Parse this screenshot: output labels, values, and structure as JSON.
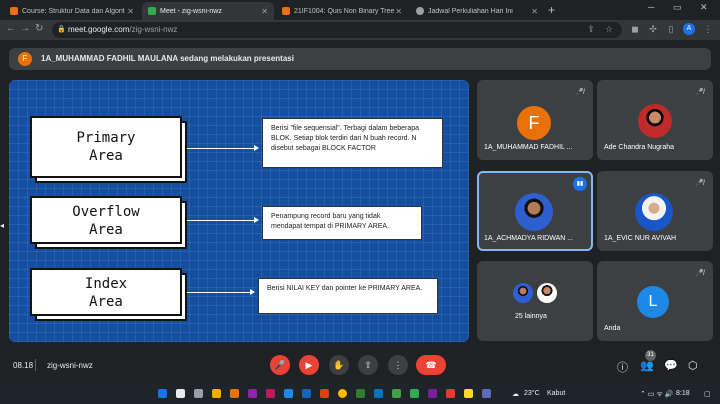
{
  "browser": {
    "tabs": [
      {
        "title": "Course: Struktur Data dan Algorit",
        "favicon_color": "#e8710a"
      },
      {
        "title": "Meet - zig-wsni-nwz",
        "favicon_color": "#34a853"
      },
      {
        "title": "21IF1004: Quis Non Binary Tree",
        "favicon_color": "#e8710a"
      },
      {
        "title": "Jadwal Perkuliahan Hari Ini",
        "favicon_color": "#9aa0a6"
      }
    ],
    "url_host": "meet.google.com",
    "url_path": "/zig-wsni-nwz",
    "profile_initial": "A"
  },
  "banner": {
    "avatar_initial": "F",
    "text": "1A_MUHAMMAD FADHIL MAULANA sedang melakukan presentasi"
  },
  "slide": {
    "boxes": [
      {
        "label_line1": "Primary",
        "label_line2": "Area",
        "description": "Berisi \"file sequensial\". Terbagi dalam beberapa BLOK. Setiap blok terdiri dari N buah record. N disebut sebagai BLOCK FACTOR"
      },
      {
        "label_line1": "Overflow",
        "label_line2": "Area",
        "description": "Penampung record baru yang tidak mendapat tempat di PRIMARY AREA."
      },
      {
        "label_line1": "Index",
        "label_line2": "Area",
        "description": "Berisi NILAI KEY dan pointer ke PRIMARY AREA."
      }
    ]
  },
  "participants": [
    {
      "name": "1A_MUHAMMAD FADHIL ...",
      "avatar_initial": "F",
      "avatar_color": "#e8710a"
    },
    {
      "name": "Ade Chandra Nugraha",
      "avatar_initial": "",
      "avatar_color": "#c02a2a"
    },
    {
      "name": "1A_ACHMADYA RIDWAN ...",
      "avatar_initial": "",
      "avatar_color": "#2d5fd0"
    },
    {
      "name": "1A_EVIC NUR AVIVAH",
      "avatar_initial": "",
      "avatar_color": "#1a56c8"
    },
    {
      "name": "25 lainnya",
      "avatar_initial": "",
      "avatar_color": "#2d5fd0"
    },
    {
      "name": "Anda",
      "avatar_initial": "L",
      "avatar_color": "#1e88e5"
    }
  ],
  "meeting": {
    "time": "08.18",
    "code": "zig-wsni-nwz",
    "participant_count": "31"
  },
  "taskbar": {
    "weather": "23°C",
    "weather_text": "Kabut",
    "clock": "8:18"
  }
}
